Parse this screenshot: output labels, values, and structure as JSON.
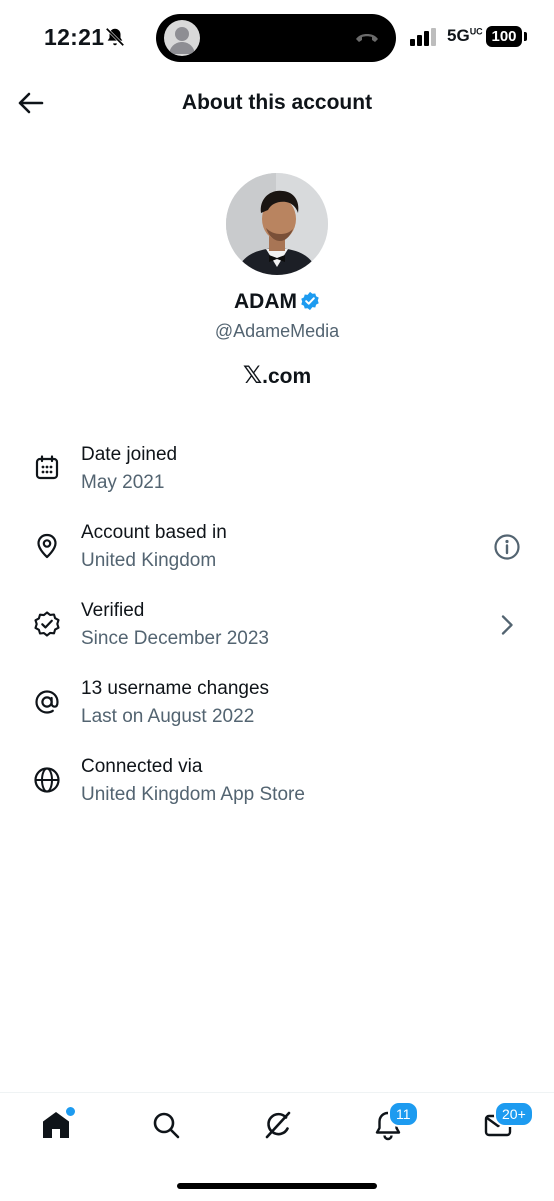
{
  "status_bar": {
    "time": "12:21",
    "network": "5G",
    "network_suffix": "UC",
    "battery": "100",
    "icons": [
      "bell-slash-icon",
      "signal-bars-icon",
      "end-call-icon"
    ]
  },
  "header": {
    "title": "About this account",
    "back_icon": "arrow-left-icon"
  },
  "profile": {
    "name": "ADAM",
    "handle": "@AdameMedia",
    "affiliation_mark": "𝕏",
    "affiliation_text": ".com",
    "verified_color": "#1d9bf0"
  },
  "info": [
    {
      "icon": "calendar-icon",
      "title": "Date joined",
      "subtitle": "May 2021"
    },
    {
      "icon": "location-pin-icon",
      "title": "Account based in",
      "subtitle": "United Kingdom",
      "action_icon": "info-circle-icon"
    },
    {
      "icon": "verified-badge-outline-icon",
      "title": "Verified",
      "subtitle": "Since December 2023",
      "action_icon": "chevron-right-icon"
    },
    {
      "icon": "at-sign-icon",
      "title": "13 username changes",
      "subtitle": "Last on August 2022"
    },
    {
      "icon": "globe-icon",
      "title": "Connected via",
      "subtitle": "United Kingdom App Store"
    }
  ],
  "bottom_nav": {
    "items": [
      "home-icon",
      "search-icon",
      "grok-icon",
      "notifications-icon",
      "messages-icon"
    ],
    "notifications_badge": "11",
    "messages_badge": "20+"
  },
  "colors": {
    "text_primary": "#0f1419",
    "text_secondary": "#536471",
    "accent": "#1d9bf0"
  }
}
